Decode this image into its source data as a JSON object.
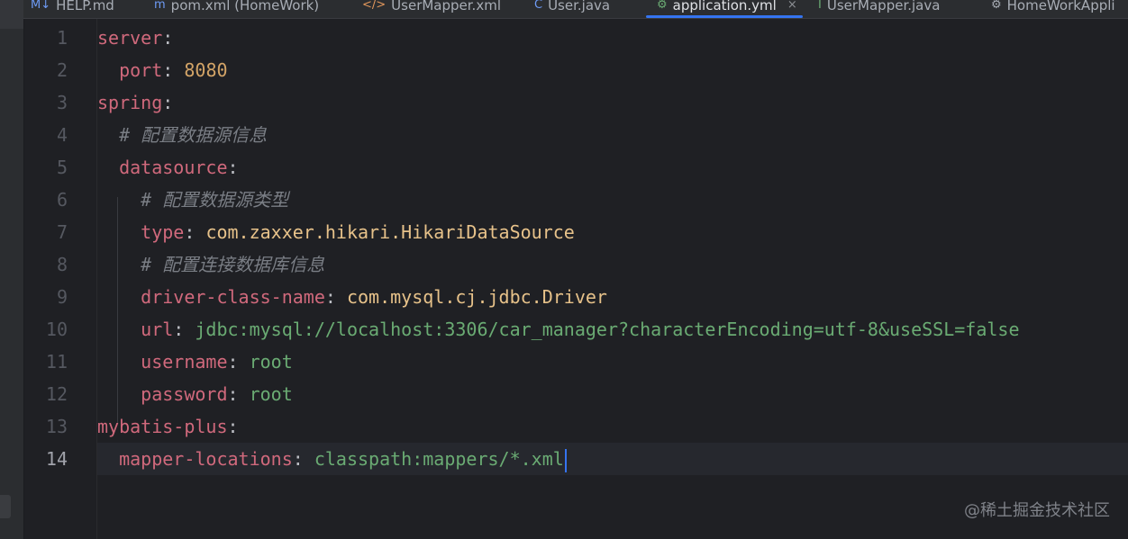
{
  "tabs": [
    {
      "icon": "M↓",
      "label": "HELP.md",
      "active": false
    },
    {
      "icon": "m",
      "label": "pom.xml (HomeWork)",
      "active": false
    },
    {
      "icon": "</>",
      "label": "UserMapper.xml",
      "active": false
    },
    {
      "icon": "C",
      "label": "User.java",
      "active": false
    },
    {
      "icon": "⚙",
      "label": "application.yml",
      "active": true,
      "close": "×"
    },
    {
      "icon": "I",
      "label": "UserMapper.java",
      "active": false
    },
    {
      "icon": "⚙",
      "label": "HomeWorkAppli",
      "active": false
    }
  ],
  "editor": {
    "current_line": 14,
    "lines": [
      {
        "num": "1",
        "indent": "",
        "key": "server",
        "sep": ":",
        "value": "",
        "value_type": ""
      },
      {
        "num": "2",
        "indent": "  ",
        "key": "port",
        "sep": ": ",
        "value": "8080",
        "value_type": "num"
      },
      {
        "num": "3",
        "indent": "",
        "key": "spring",
        "sep": ":",
        "value": "",
        "value_type": ""
      },
      {
        "num": "4",
        "indent": "  ",
        "comment": "# 配置数据源信息"
      },
      {
        "num": "5",
        "indent": "  ",
        "key": "datasource",
        "sep": ":",
        "value": "",
        "value_type": ""
      },
      {
        "num": "6",
        "indent": "    ",
        "comment": "# 配置数据源类型"
      },
      {
        "num": "7",
        "indent": "    ",
        "key": "type",
        "sep": ": ",
        "value": "com.zaxxer.hikari.HikariDataSource",
        "value_type": "str"
      },
      {
        "num": "8",
        "indent": "    ",
        "comment": "# 配置连接数据库信息"
      },
      {
        "num": "9",
        "indent": "    ",
        "key": "driver-class-name",
        "sep": ": ",
        "value": "com.mysql.cj.jdbc.Driver",
        "value_type": "str"
      },
      {
        "num": "10",
        "indent": "    ",
        "key": "url",
        "sep": ": ",
        "value": "jdbc:mysql://localhost:3306/car_manager?characterEncoding=utf-8&useSSL=false",
        "value_type": "val"
      },
      {
        "num": "11",
        "indent": "    ",
        "key": "username",
        "sep": ": ",
        "value": "root",
        "value_type": "val"
      },
      {
        "num": "12",
        "indent": "    ",
        "key": "password",
        "sep": ": ",
        "value": "root",
        "value_type": "val"
      },
      {
        "num": "13",
        "indent": "",
        "key": "mybatis-plus",
        "sep": ":",
        "value": "",
        "value_type": ""
      },
      {
        "num": "14",
        "indent": "  ",
        "key": "mapper-locations",
        "sep": ": ",
        "value": "classpath:mappers/*.xml",
        "value_type": "val"
      }
    ]
  },
  "watermark": "@稀土掘金技术社区",
  "colors": {
    "background": "#1f2024",
    "key": "#d0697c",
    "number": "#d3a467",
    "string": "#e7c28a",
    "value": "#6aab73",
    "comment": "#7a7e85",
    "accent": "#3574f0"
  }
}
